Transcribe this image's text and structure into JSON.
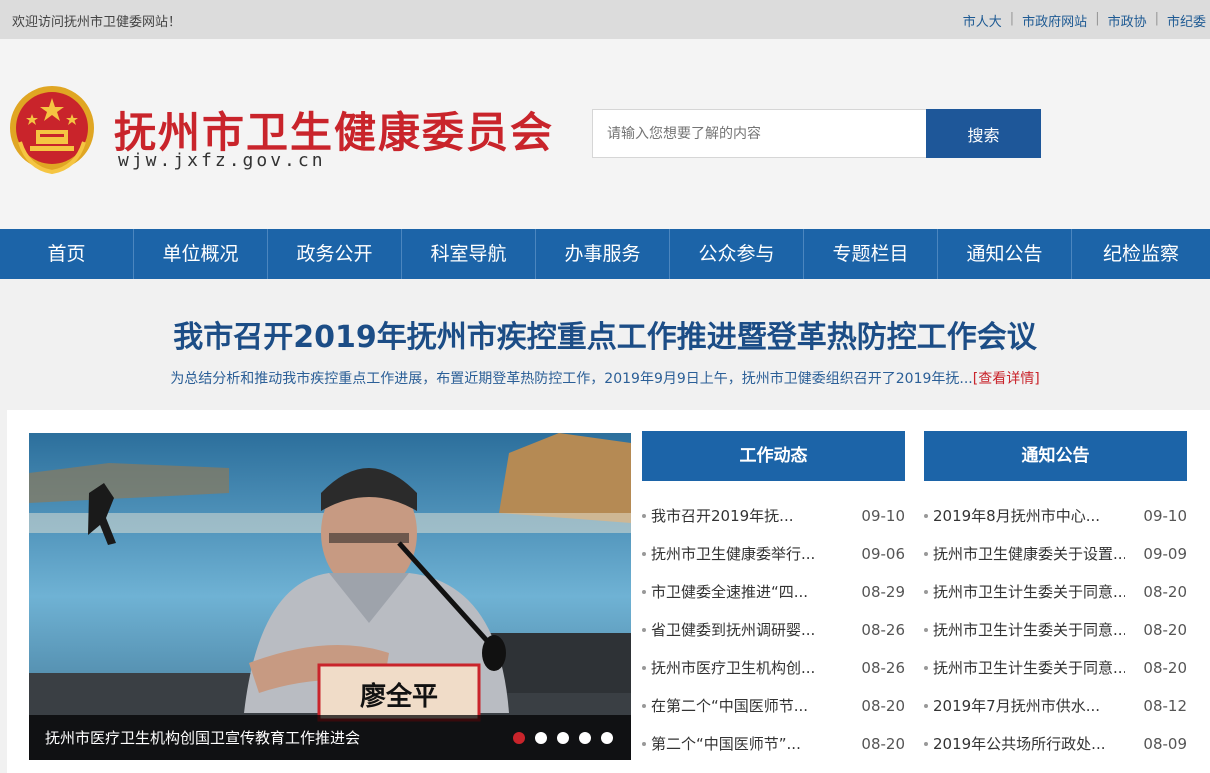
{
  "topbar": {
    "welcome": "欢迎访问抚州市卫健委网站！",
    "links": [
      "市人大",
      "市政府网站",
      "市政协",
      "市纪委"
    ]
  },
  "header": {
    "title": "抚州市卫生健康委员会",
    "url": "wjw.jxfz.gov.cn",
    "search_placeholder": "请输入您想要了解的内容",
    "search_button": "搜索"
  },
  "nav": [
    "首页",
    "单位概况",
    "政务公开",
    "科室导航",
    "办事服务",
    "公众参与",
    "专题栏目",
    "通知公告",
    "纪检监察"
  ],
  "headline": {
    "title": "我市召开2019年抚州市疾控重点工作推进暨登革热防控工作会议",
    "summary": "为总结分析和推动我市疾控重点工作进展，布置近期登革热防控工作，2019年9月9日上午，抚州市卫健委组织召开了2019年抚...",
    "more": "[查看详情]"
  },
  "slider": {
    "caption": "抚州市医疗卫生机构创国卫宣传教育工作推进会",
    "nameplate": "廖全平",
    "dots": 5,
    "active_index": 0
  },
  "work_news": {
    "title": "工作动态",
    "items": [
      {
        "title": "我市召开2019年抚...",
        "date": "09-10"
      },
      {
        "title": "抚州市卫生健康委举行...",
        "date": "09-06"
      },
      {
        "title": "市卫健委全速推进“四...",
        "date": "08-29"
      },
      {
        "title": "省卫健委到抚州调研婴...",
        "date": "08-26"
      },
      {
        "title": "抚州市医疗卫生机构创...",
        "date": "08-26"
      },
      {
        "title": "在第二个“中国医师节...",
        "date": "08-20"
      },
      {
        "title": "第二个“中国医师节”...",
        "date": "08-20"
      }
    ]
  },
  "notices": {
    "title": "通知公告",
    "items": [
      {
        "title": "2019年8月抚州市中心...",
        "date": "09-10"
      },
      {
        "title": "抚州市卫生健康委关于设置...",
        "date": "09-09"
      },
      {
        "title": "抚州市卫生计生委关于同意...",
        "date": "08-20"
      },
      {
        "title": "抚州市卫生计生委关于同意...",
        "date": "08-20"
      },
      {
        "title": "抚州市卫生计生委关于同意...",
        "date": "08-20"
      },
      {
        "title": "2019年7月抚州市供水...",
        "date": "08-12"
      },
      {
        "title": "2019年公共场所行政处...",
        "date": "08-09"
      }
    ]
  },
  "colors": {
    "brand_blue": "#1c64a8",
    "title_red": "#c9242b",
    "headline_blue": "#1c4d86"
  }
}
